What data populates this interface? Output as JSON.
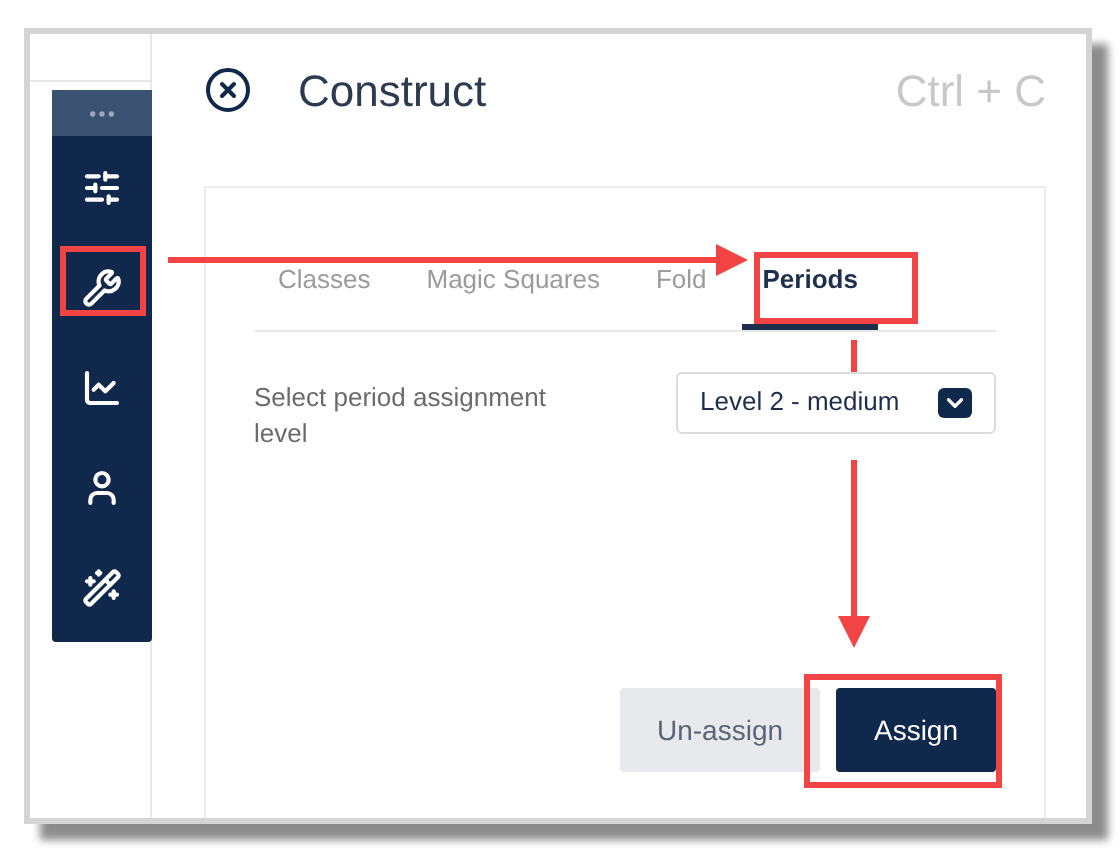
{
  "window": {
    "title": "Construct",
    "shortcut": "Ctrl + C"
  },
  "tabs": [
    {
      "label": "Classes",
      "selected": false
    },
    {
      "label": "Magic Squares",
      "selected": false
    },
    {
      "label": "Fold",
      "selected": false
    },
    {
      "label": "Periods",
      "selected": true
    }
  ],
  "field": {
    "label": "Select period assignment level",
    "value": "Level 2 - medium"
  },
  "buttons": [
    {
      "label": "Un-assign",
      "kind": "secondary"
    },
    {
      "label": "Assign",
      "kind": "primary"
    }
  ]
}
